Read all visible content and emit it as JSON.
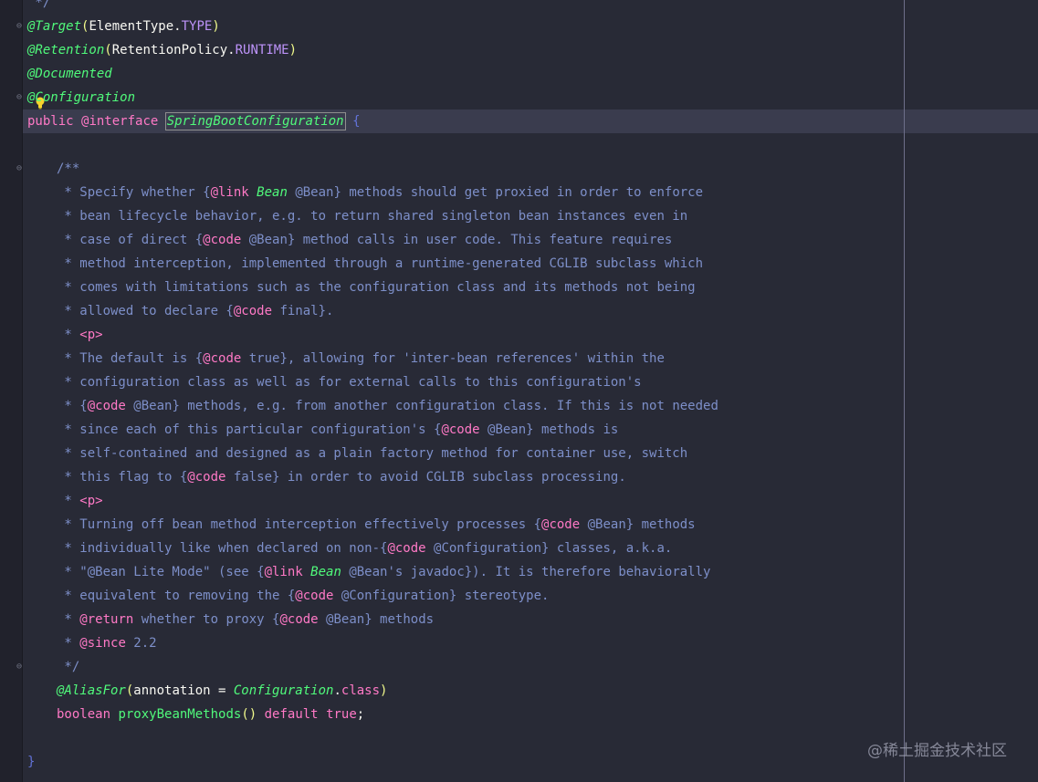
{
  "editor": {
    "language": "java",
    "theme_colors": {
      "background": "#282a36",
      "gutter": "#21222c",
      "current_line": "#3a3c4e",
      "comment": "#7d8fc9",
      "keyword": "#ff79c6",
      "annotation": "#50fa7b",
      "paren": "#f1fa8c"
    },
    "lines": {
      "l0": " */",
      "l1_anno": "@Target",
      "l1_open": "(",
      "l1_cls": "ElementType",
      "l1_dot": ".",
      "l1_const": "TYPE",
      "l1_close": ")",
      "l2_anno": "@Retention",
      "l2_open": "(",
      "l2_cls": "RetentionPolicy",
      "l2_dot": ".",
      "l2_const": "RUNTIME",
      "l2_close": ")",
      "l3_anno": "@Documented",
      "l4_anno": "@Configuration",
      "l5_kw1": "public",
      "l5_kw2": "@interface",
      "l5_name": "SpringBootConfiguration",
      "l5_brace": "{",
      "c0": "/**",
      "c1a": " * Specify whether {",
      "c1b": "@link",
      "c1c": "Bean",
      "c1d": " @Bean} methods should get proxied in order to enforce",
      "c2": " * bean lifecycle behavior, e.g. to return shared singleton bean instances even in",
      "c3a": " * case of direct {",
      "c3b": "@code",
      "c3c": " @Bean} method calls in user code. This feature requires",
      "c4": " * method interception, implemented through a runtime-generated CGLIB subclass which",
      "c5": " * comes with limitations such as the configuration class and its methods not being",
      "c6a": " * allowed to declare {",
      "c6b": "@code",
      "c6c": " final}.",
      "c7a": " * ",
      "c7b": "<p>",
      "c8a": " * The default is {",
      "c8b": "@code",
      "c8c": " true}, allowing for 'inter-bean references' within the",
      "c9": " * configuration class as well as for external calls to this configuration's",
      "c10a": " * {",
      "c10b": "@code",
      "c10c": " @Bean} methods, e.g. from another configuration class. If this is not needed",
      "c11a": " * since each of this particular configuration's {",
      "c11b": "@code",
      "c11c": " @Bean} methods is",
      "c12": " * self-contained and designed as a plain factory method for container use, switch",
      "c13a": " * this flag to {",
      "c13b": "@code",
      "c13c": " false} in order to avoid CGLIB subclass processing.",
      "c14a": " * ",
      "c14b": "<p>",
      "c15a": " * Turning off bean method interception effectively processes {",
      "c15b": "@code",
      "c15c": " @Bean} methods",
      "c16a": " * individually like when declared on non-{",
      "c16b": "@code",
      "c16c": " @Configuration} classes, a.k.a.",
      "c17a": " * \"@Bean Lite Mode\" (see {",
      "c17b": "@link",
      "c17c": "Bean",
      "c17d": " @Bean's javadoc}). It is therefore behaviorally",
      "c18a": " * equivalent to removing the {",
      "c18b": "@code",
      "c18c": " @Configuration} stereotype.",
      "c19a": " * ",
      "c19b": "@return",
      "c19c": " whether to proxy {",
      "c19d": "@code",
      "c19e": " @Bean} methods",
      "c20a": " * ",
      "c20b": "@since",
      "c20c": " 2.2",
      "c21": " */",
      "m1_anno": "@AliasFor",
      "m1_open": "(",
      "m1_arg": "annotation = ",
      "m1_cls": "Configuration",
      "m1_dot": ".",
      "m1_kw": "class",
      "m1_close": ")",
      "m2_kw1": "boolean",
      "m2_name": "proxyBeanMethods",
      "m2_parens": "()",
      "m2_kw2": "default",
      "m2_kw3": "true",
      "m2_semi": ";",
      "end_brace": "}"
    }
  },
  "watermark": "@稀土掘金技术社区"
}
